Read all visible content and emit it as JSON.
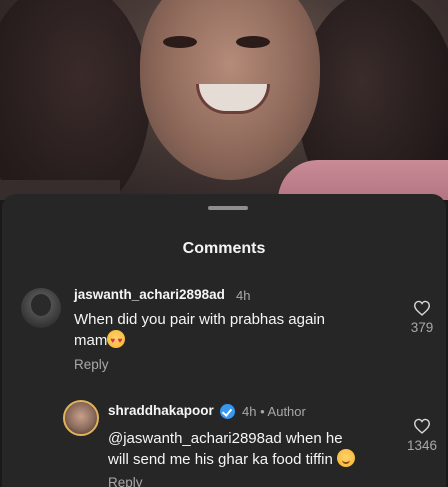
{
  "sheet": {
    "title": "Comments"
  },
  "comments": [
    {
      "username": "jaswanth_achari2898ad",
      "time": "4h",
      "text_line1": "When did you pair with prabhas again",
      "text_line2": "mam",
      "emoji": "smiling-face-with-heart-eyes",
      "reply_label": "Reply",
      "like_count": "379"
    },
    {
      "username": "shraddhakapoor",
      "verified": true,
      "time": "4h",
      "author_label": "Author",
      "text_line1": "@jaswanth_achari2898ad when he",
      "text_line2": "will send me his ghar ka food tiffin",
      "emoji": "smiling-face",
      "reply_label": "Reply",
      "like_count": "1346"
    }
  ],
  "colors": {
    "sheet_bg": "#262626",
    "muted": "#a8a8a8",
    "verified": "#3897f0"
  }
}
